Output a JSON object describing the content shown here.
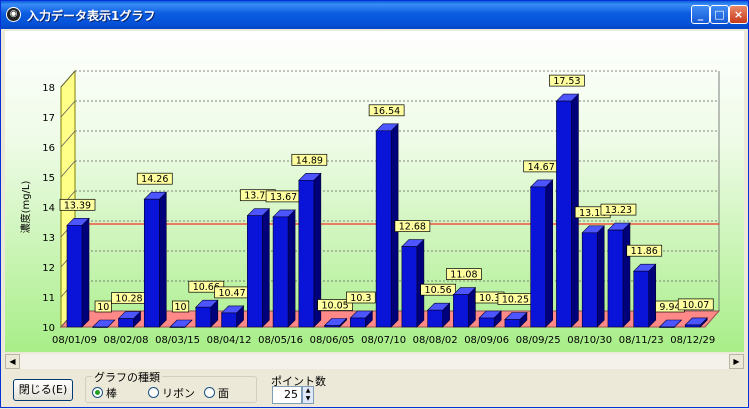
{
  "window": {
    "title": "入力データ表示1グラフ"
  },
  "titlebar_buttons": {
    "minimize": "_",
    "maximize": "□",
    "close": "×"
  },
  "chart_data": {
    "type": "bar",
    "ylabel": "濃度(mg/L)",
    "ylim": [
      10,
      18
    ],
    "yticks": [
      "10",
      "11",
      "12",
      "13",
      "14",
      "15",
      "16",
      "17",
      "18"
    ],
    "threshold": 12.9,
    "xticks": [
      "08/01/09",
      "08/02/08",
      "08/03/15",
      "08/04/12",
      "08/05/16",
      "08/06/05",
      "08/07/10",
      "08/08/02",
      "08/09/06",
      "08/09/25",
      "08/10/30",
      "08/11/23",
      "08/12/29"
    ],
    "values": [
      13.39,
      10,
      10.28,
      14.26,
      10,
      10.66,
      10.47,
      13.71,
      13.67,
      14.89,
      10.05,
      10.3,
      16.54,
      12.68,
      10.56,
      11.08,
      10.3,
      10.25,
      14.67,
      17.53,
      13.14,
      13.23,
      11.86,
      9.94,
      10.07
    ],
    "labels": [
      "13.39",
      "10",
      "10.28",
      "14.26",
      "10",
      "10.66",
      "10.47",
      "13.71",
      "13.67",
      "14.89",
      "10.05",
      "10.3",
      "16.54",
      "12.68",
      "10.56",
      "11.08",
      "10.3",
      "10.25",
      "14.67",
      "17.53",
      "13.14",
      "13.23",
      "11.86",
      "9.94",
      "10.07"
    ],
    "colors": {
      "bar": "#0a14d8",
      "floor": "#ff8888",
      "wall": "#ffff88",
      "threshold": "#ff0000"
    }
  },
  "controls": {
    "close_button": "閉じる(E)",
    "chart_type_label": "グラフの種類",
    "radio_bar": "棒",
    "radio_ribbon": "リボン",
    "radio_face": "面",
    "selected": "棒",
    "points_label": "ポイント数",
    "points_value": "25"
  }
}
